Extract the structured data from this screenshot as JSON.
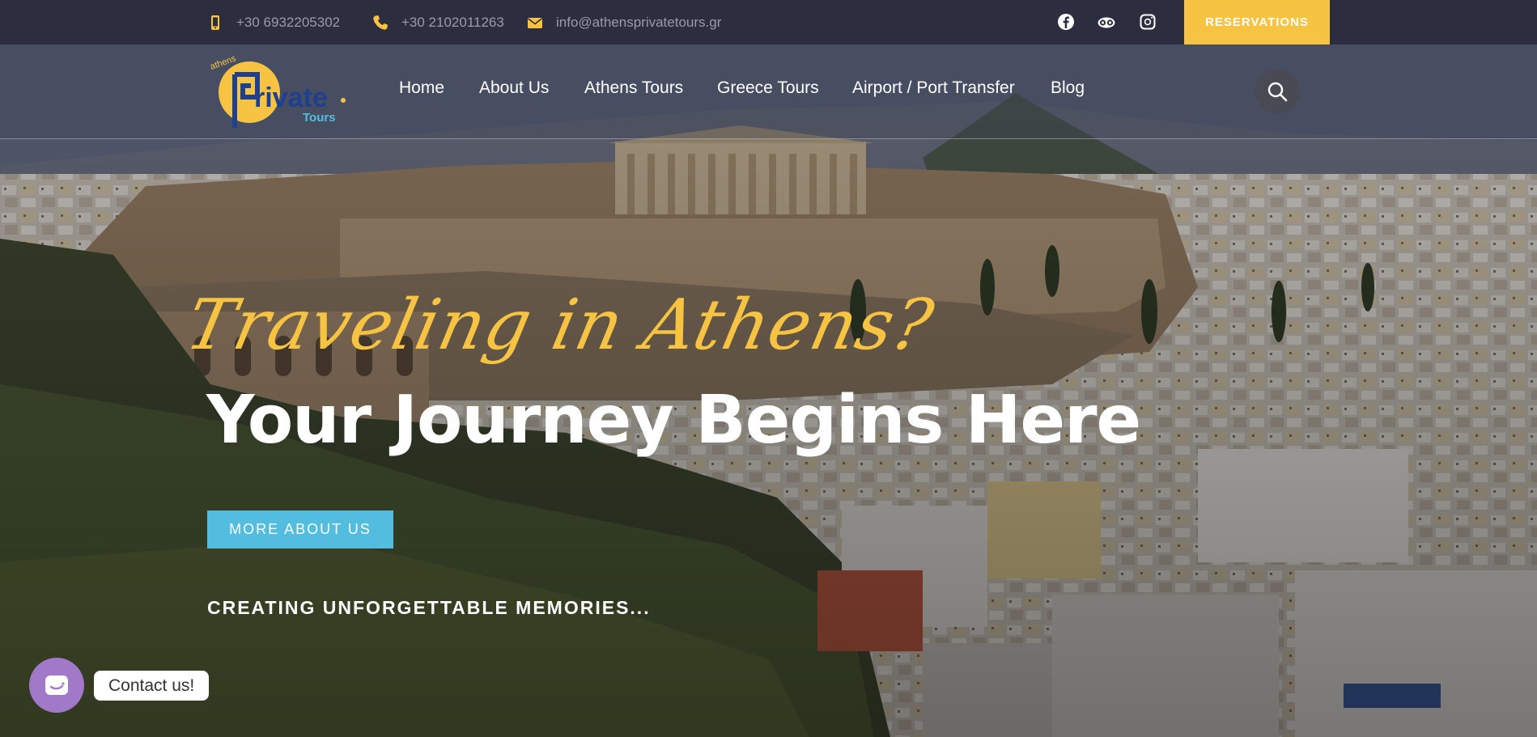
{
  "topbar": {
    "mobile_phone": "+30 6932205302",
    "landline_phone": "+30 2102011263",
    "email": "info@athensprivatetours.gr",
    "reservations_label": "RESERVATIONS"
  },
  "logo": {
    "small_text": "athens",
    "main_text": "rivate",
    "sub_text": "Tours"
  },
  "nav": {
    "items": [
      {
        "label": "Home"
      },
      {
        "label": "About Us"
      },
      {
        "label": "Athens Tours"
      },
      {
        "label": "Greece Tours"
      },
      {
        "label": "Airport / Port Transfer"
      },
      {
        "label": "Blog"
      }
    ]
  },
  "hero": {
    "script_title": "Traveling in Athens?",
    "main_title": "Your Journey Begins Here",
    "cta_label": "MORE ABOUT US",
    "tagline": "CREATING UNFORGETTABLE MEMORIES..."
  },
  "contact_widget": {
    "label": "Contact us!"
  },
  "colors": {
    "accent_yellow": "#f7c343",
    "topbar_bg": "#2d2d40",
    "cta_blue": "#53bde0",
    "chat_purple": "#a079c9"
  },
  "icons": [
    "mobile-phone-icon",
    "phone-icon",
    "envelope-icon",
    "facebook-icon",
    "tripadvisor-icon",
    "instagram-icon",
    "search-icon",
    "chat-icon"
  ]
}
